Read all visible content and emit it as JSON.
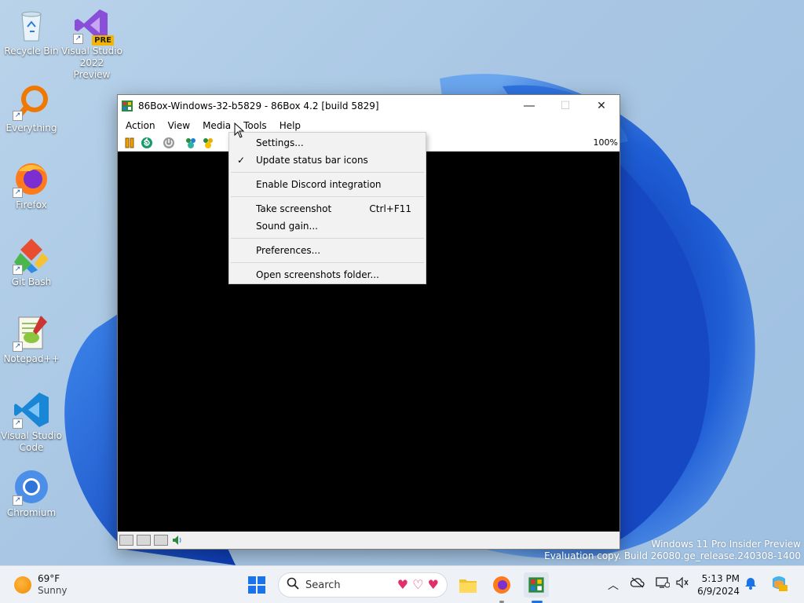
{
  "desktop": {
    "icons": [
      {
        "label": "Recycle Bin",
        "icon": "recycle-bin-icon"
      },
      {
        "label": "Visual Studio 2022 Preview",
        "badge": "PRE",
        "icon": "visual-studio-icon"
      },
      {
        "label": "Everything",
        "icon": "everything-search-icon"
      },
      {
        "label": "Firefox",
        "icon": "firefox-icon"
      },
      {
        "label": "Git Bash",
        "icon": "git-bash-icon"
      },
      {
        "label": "Notepad++",
        "icon": "notepad-plus-plus-icon"
      },
      {
        "label": "Visual Studio Code",
        "icon": "vscode-icon"
      },
      {
        "label": "Chromium",
        "icon": "chromium-icon"
      }
    ]
  },
  "window": {
    "title": "86Box-Windows-32-b5829 - 86Box 4.2 [build 5829]",
    "menu": [
      "Action",
      "View",
      "Media",
      "Tools",
      "Help"
    ],
    "zoom": "100%"
  },
  "tools_menu": {
    "items": [
      {
        "label": "Settings...",
        "checked": false,
        "shortcut": ""
      },
      {
        "label": "Update status bar icons",
        "checked": true,
        "shortcut": ""
      },
      {
        "label": "Enable Discord integration",
        "checked": false,
        "shortcut": ""
      },
      {
        "label": "Take screenshot",
        "checked": false,
        "shortcut": "Ctrl+F11"
      },
      {
        "label": "Sound gain...",
        "checked": false,
        "shortcut": ""
      },
      {
        "label": "Preferences...",
        "checked": false,
        "shortcut": ""
      },
      {
        "label": "Open screenshots folder...",
        "checked": false,
        "shortcut": ""
      }
    ],
    "check_glyph": "✓"
  },
  "watermark": {
    "line1": "Windows 11 Pro Insider Preview",
    "line2": "Evaluation copy. Build 26080.ge_release.240308-1400"
  },
  "taskbar": {
    "weather_temp": "69°F",
    "weather_cond": "Sunny",
    "search_placeholder": "Search",
    "time": "5:13 PM",
    "date": "6/9/2024"
  },
  "colors": {
    "accent": "#1a73e8",
    "wallpaper_blue": "#1f5fd6"
  }
}
